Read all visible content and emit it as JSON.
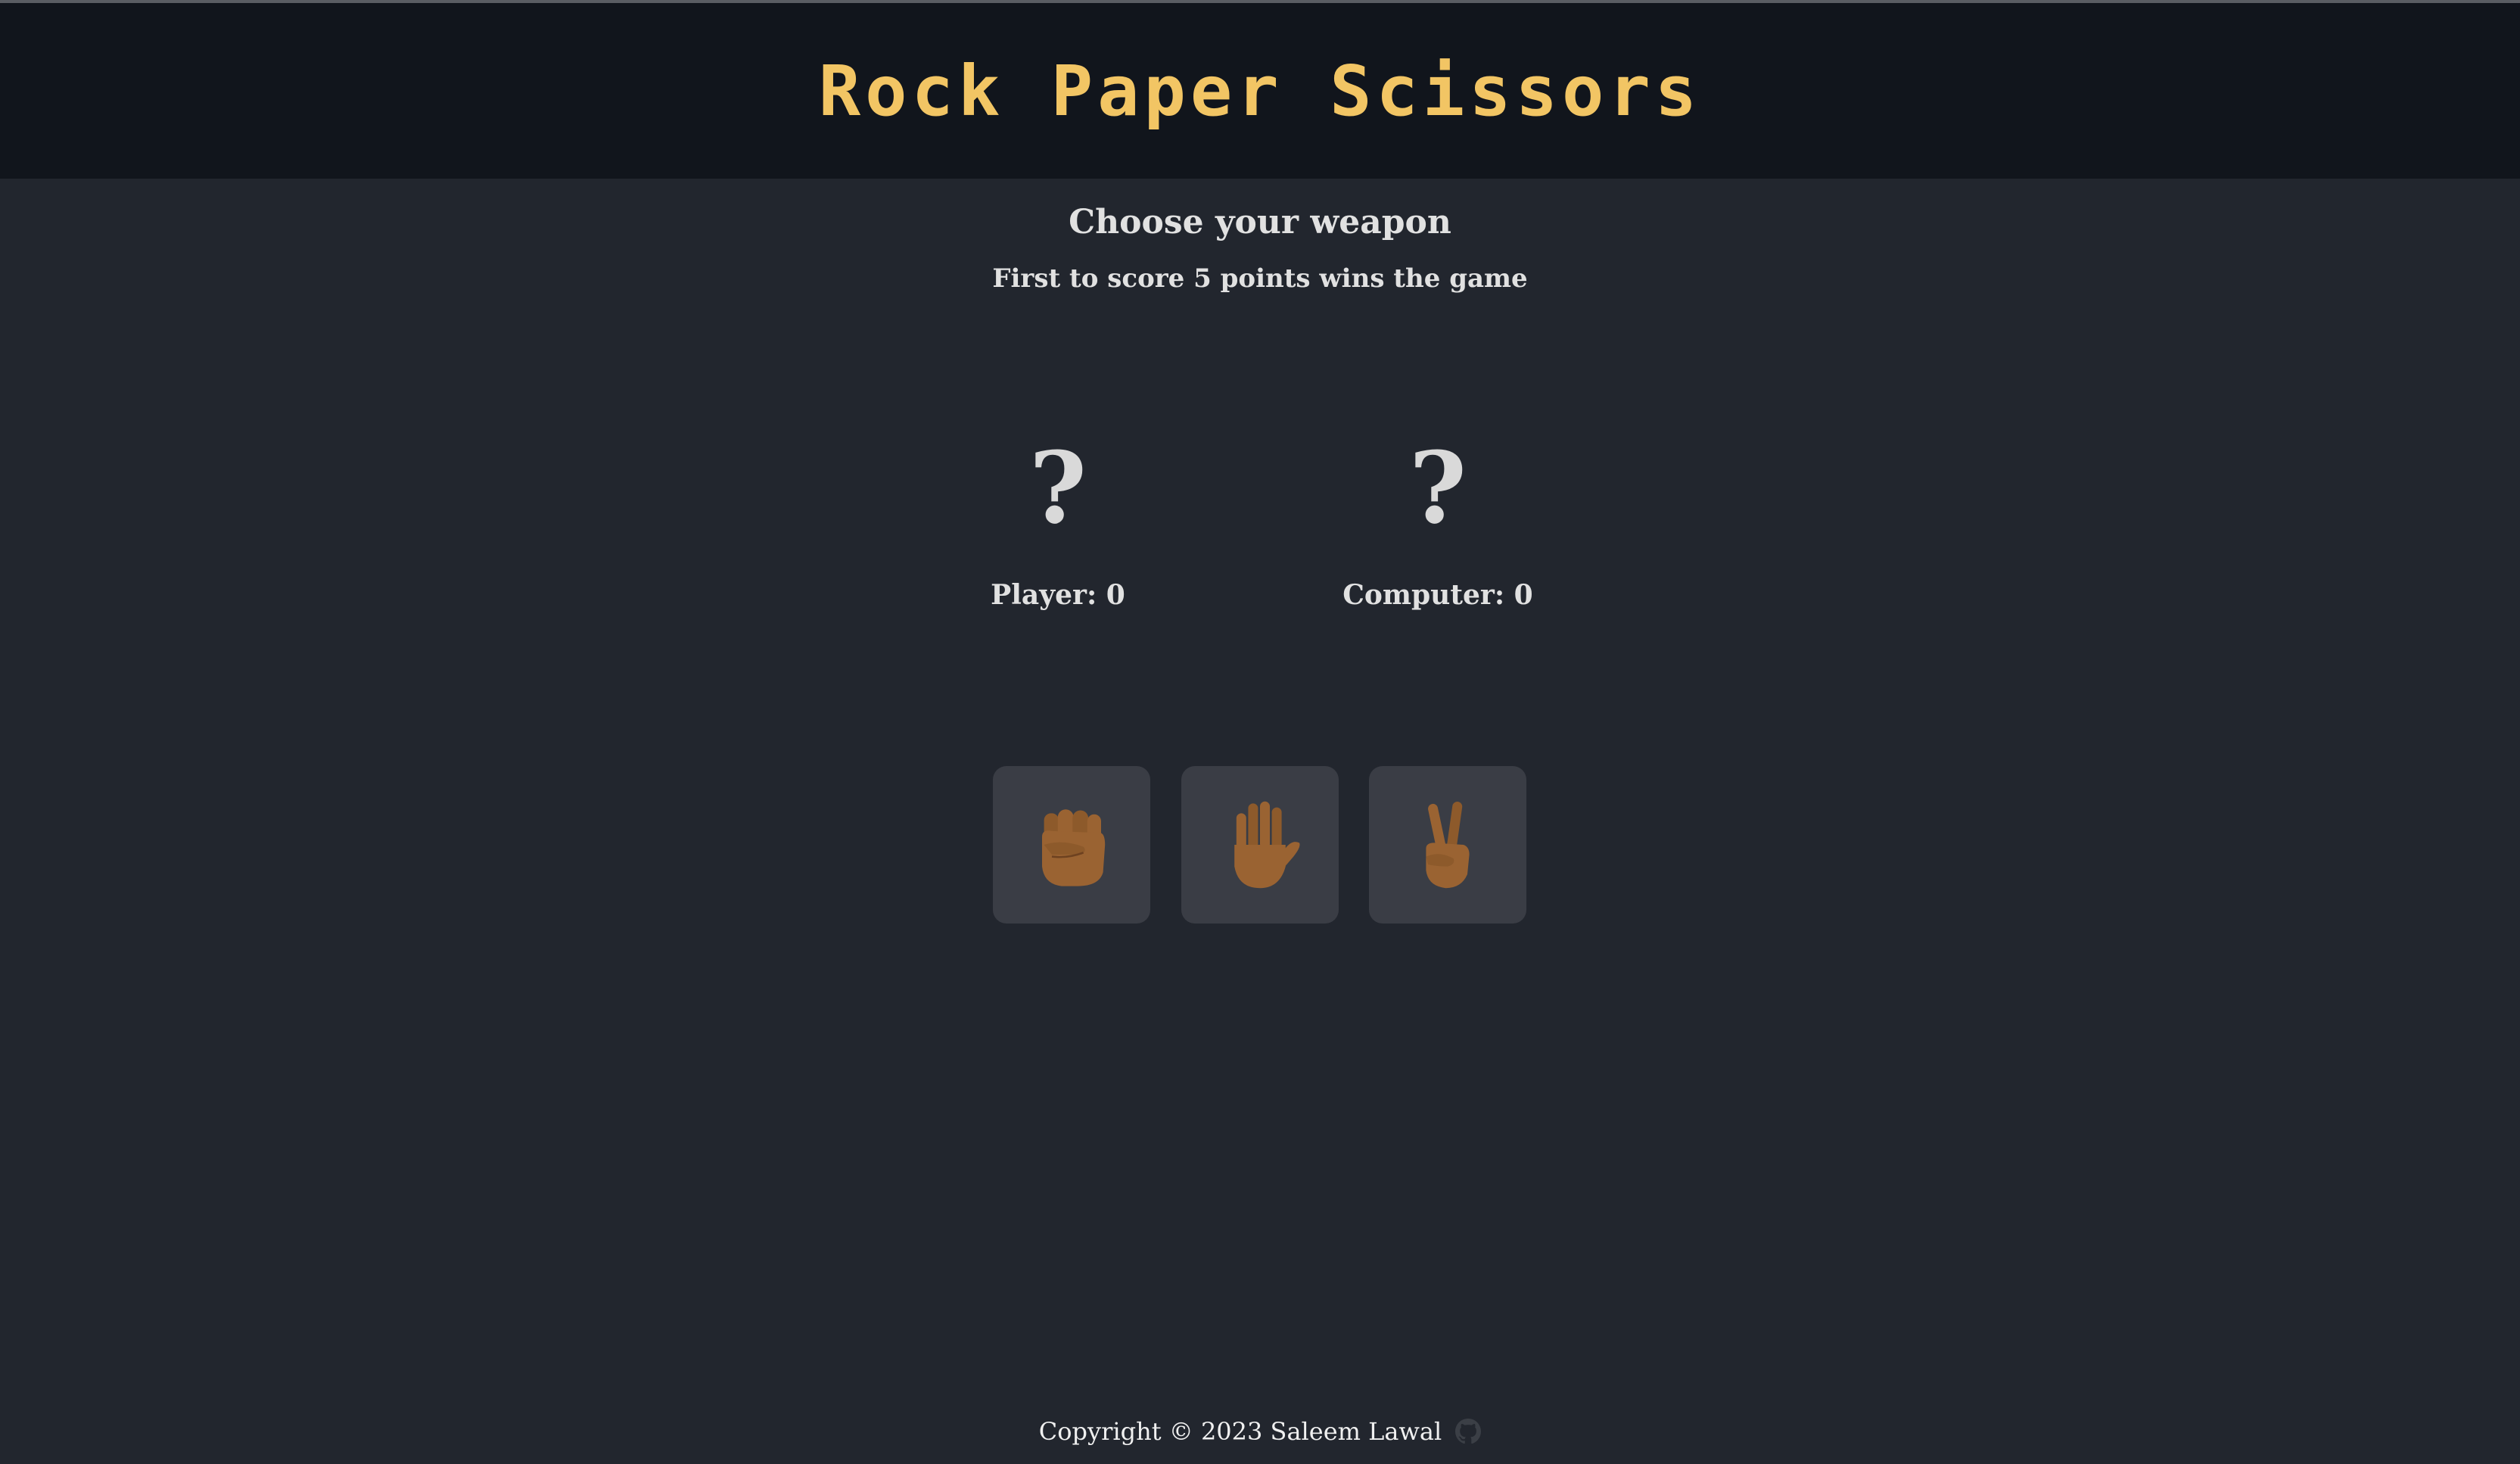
{
  "header": {
    "title": "Rock Paper Scissors",
    "title_color": "#f2c564",
    "background": "#11151c"
  },
  "intro": {
    "heading": "Choose your weapon",
    "subheading": "First to score 5 points wins the game"
  },
  "board": {
    "player_choice": "?",
    "computer_choice": "?",
    "player_score_label": "Player: 0",
    "computer_score_label": "Computer: 0",
    "player_score": 0,
    "computer_score": 0
  },
  "weapons": [
    {
      "id": "rock",
      "icon": "raised-fist-icon"
    },
    {
      "id": "paper",
      "icon": "raised-hand-icon"
    },
    {
      "id": "scissors",
      "icon": "victory-hand-icon"
    }
  ],
  "footer": {
    "copyright": "Copyright © 2023 Saleem Lawal",
    "icon": "github-icon"
  },
  "colors": {
    "page_background": "#22262e",
    "button_background": "#3a3d45",
    "skin_tone": "#9a6332"
  }
}
